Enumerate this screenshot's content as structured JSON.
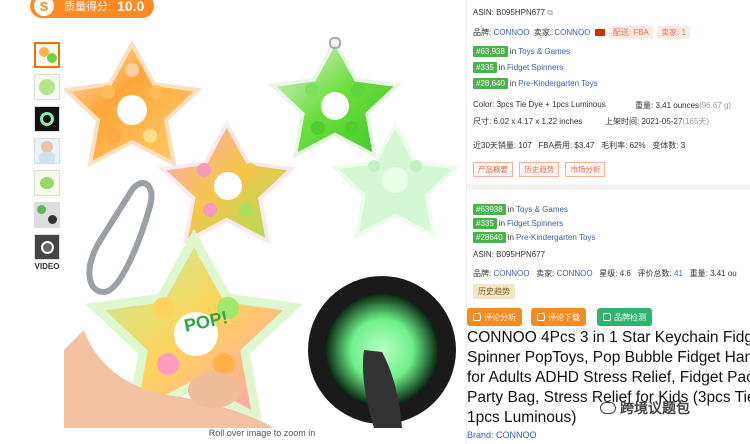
{
  "score": {
    "logo": "S",
    "label": "质量得分:",
    "value": "10.0"
  },
  "gallery": {
    "video_label": "VIDEO",
    "zoom_hint": "Roll over image to zoom in",
    "pop_text": "POP!"
  },
  "info": {
    "asin_label": "ASIN:",
    "asin": "B095HPN677",
    "brand_label": "品牌:",
    "brand": "CONNOO",
    "seller_label": "卖家:",
    "seller": "CONNOO",
    "delivery_tag": "配送: FBA",
    "sellers_tag": "卖家: 1",
    "ranks": [
      {
        "rank": "#63,938",
        "in": "in",
        "category": "Toys & Games"
      },
      {
        "rank": "#335",
        "in": "in",
        "category": "Fidget Spinners"
      },
      {
        "rank": "#28,640",
        "in": "in",
        "category": "Pre-Kindergarten Toys"
      }
    ],
    "color_label": "Color:",
    "color": "3pcs Tie Dye + 1pcs Luminous",
    "weight_label": "重量:",
    "weight": "3.41 ounces",
    "weight_g": "(96.67 g)",
    "size_label": "尺寸:",
    "size": "6.02 x 4.17 x 1.22 inches",
    "date_label": "上架时间:",
    "date": "2021-05-27",
    "days": "(165天)",
    "sales_label": "近30天销量:",
    "sales": "107",
    "fba_label": "FBA费用:",
    "fba": "$3.47",
    "margin_label": "毛利率:",
    "margin": "62%",
    "variants_label": "变体数:",
    "variants": "3",
    "tool_buttons": [
      "产品概要",
      "历史趋势",
      "市场分析"
    ]
  },
  "info2": {
    "ranks": [
      {
        "rank": "#63938",
        "in": "in",
        "category": "Toys & Games"
      },
      {
        "rank": "#335",
        "in": "in",
        "category": "Fidget Spinners"
      },
      {
        "rank": "#28640",
        "in": "in",
        "category": "Pre-Kindergarten Toys"
      }
    ],
    "asin_label": "ASIN:",
    "asin": "B095HPN677",
    "brand_label": "品牌:",
    "brand": "CONNOO",
    "seller_label": "卖家:",
    "seller": "CONNOO",
    "stars_label": "星级:",
    "stars": "4.6",
    "reviews_label": "评价总数:",
    "reviews": "41",
    "weight_label": "重量:",
    "weight": "3.41 ou",
    "history_button": "历史趋势"
  },
  "actions": {
    "review_analysis": "评论分析",
    "review_download": "评论下载",
    "brand_check": "品牌检测"
  },
  "product": {
    "title_lines": [
      "CONNOO 4Pcs 3 in 1 Star Keychain Fidget",
      "Spinner PopToys, Pop Bubble Fidget Hand",
      "for Adults ADHD Stress Relief, Fidget Pack",
      "Party Bag, Stress Relief for Kids (3pcs Tie-",
      "1pcs Luminous)"
    ],
    "brand_line": "Brand: CONNOO"
  },
  "watermark": "跨境议题包",
  "colors": {
    "accent_orange": "#ff8a24",
    "rank_green": "#49b249",
    "link_blue": "#3f5fb6",
    "check_green": "#2fb46e"
  }
}
